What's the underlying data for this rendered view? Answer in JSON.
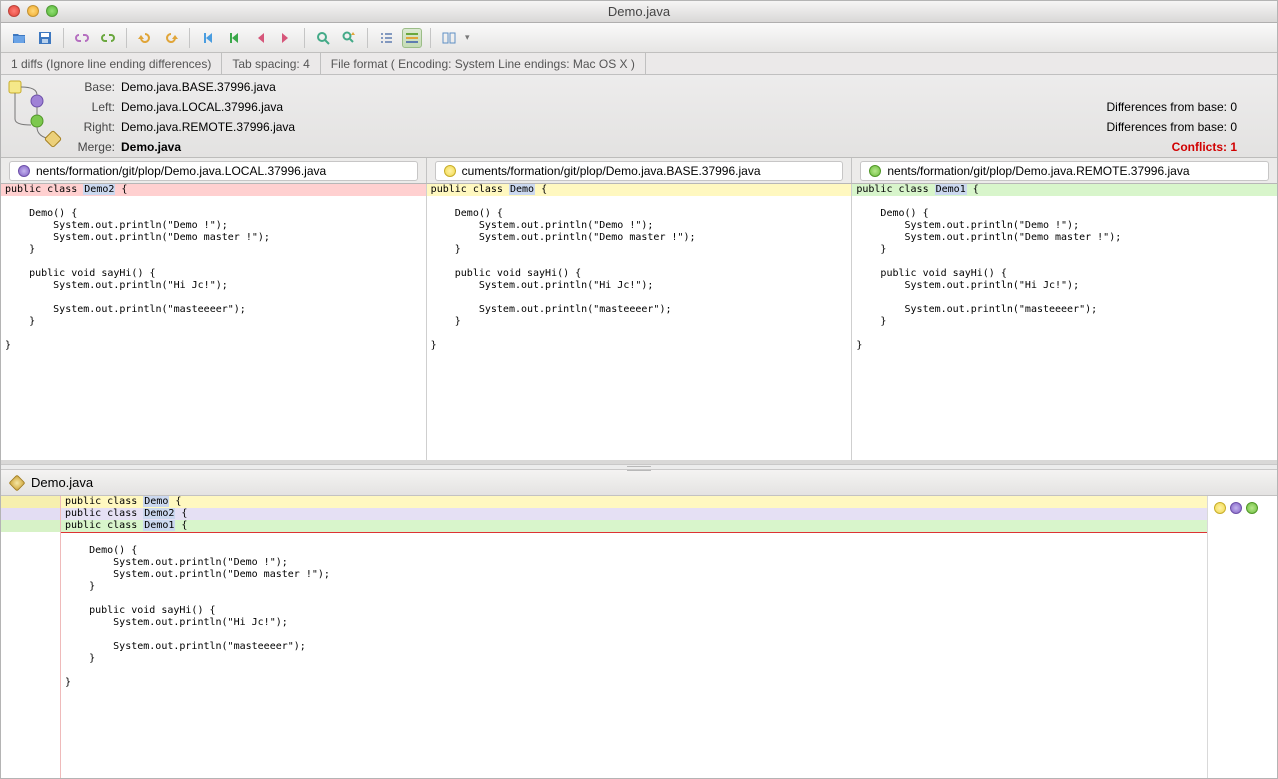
{
  "window": {
    "title": "Demo.java"
  },
  "statusbar": {
    "diffs": "1 diffs (Ignore line ending differences)",
    "tabspacing": "Tab spacing: 4",
    "fileformat": "File format ( Encoding: System  Line endings: Mac OS X )"
  },
  "header": {
    "base": {
      "label": "Base:",
      "value": "Demo.java.BASE.37996.java"
    },
    "left": {
      "label": "Left:",
      "value": "Demo.java.LOCAL.37996.java",
      "diff": "Differences from base:  0"
    },
    "right": {
      "label": "Right:",
      "value": "Demo.java.REMOTE.37996.java",
      "diff": "Differences from base:  0"
    },
    "merge": {
      "label": "Merge:",
      "value": "Demo.java",
      "diff": "Conflicts:  1"
    }
  },
  "tabs": {
    "left": "nents/formation/git/plop/Demo.java.LOCAL.37996.java",
    "base": "cuments/formation/git/plop/Demo.java.BASE.37996.java",
    "right": "nents/formation/git/plop/Demo.java.REMOTE.37996.java"
  },
  "panes": {
    "left": {
      "decl": {
        "pre": "public class ",
        "hl": "Demo2",
        "post": " {"
      },
      "body": "\n    Demo() {\n        System.out.println(\"Demo !\");\n        System.out.println(\"Demo master !\");\n    }\n\n    public void sayHi() {\n        System.out.println(\"Hi Jc!\");\n\n        System.out.println(\"masteeeer\");\n    }\n\n}"
    },
    "base": {
      "decl": {
        "pre": "public class ",
        "hl": "Demo",
        "post": " {"
      },
      "body": "\n    Demo() {\n        System.out.println(\"Demo !\");\n        System.out.println(\"Demo master !\");\n    }\n\n    public void sayHi() {\n        System.out.println(\"Hi Jc!\");\n\n        System.out.println(\"masteeeer\");\n    }\n\n}"
    },
    "right": {
      "decl": {
        "pre": "public class ",
        "hl": "Demo1",
        "post": " {"
      },
      "body": "\n    Demo() {\n        System.out.println(\"Demo !\");\n        System.out.println(\"Demo master !\");\n    }\n\n    public void sayHi() {\n        System.out.println(\"Hi Jc!\");\n\n        System.out.println(\"masteeeer\");\n    }\n\n}"
    }
  },
  "merge": {
    "title": "Demo.java",
    "lines": {
      "l1": {
        "pre": "public class ",
        "hl": "Demo",
        "post": " {"
      },
      "l2": {
        "pre": "public class ",
        "hl": "Demo2",
        "post": " {"
      },
      "l3": {
        "pre": "public class ",
        "hl": "Demo1",
        "post": " {"
      }
    },
    "body": "\n    Demo() {\n        System.out.println(\"Demo !\");\n        System.out.println(\"Demo master !\");\n    }\n\n    public void sayHi() {\n        System.out.println(\"Hi Jc!\");\n\n        System.out.println(\"masteeeer\");\n    }\n\n}"
  }
}
